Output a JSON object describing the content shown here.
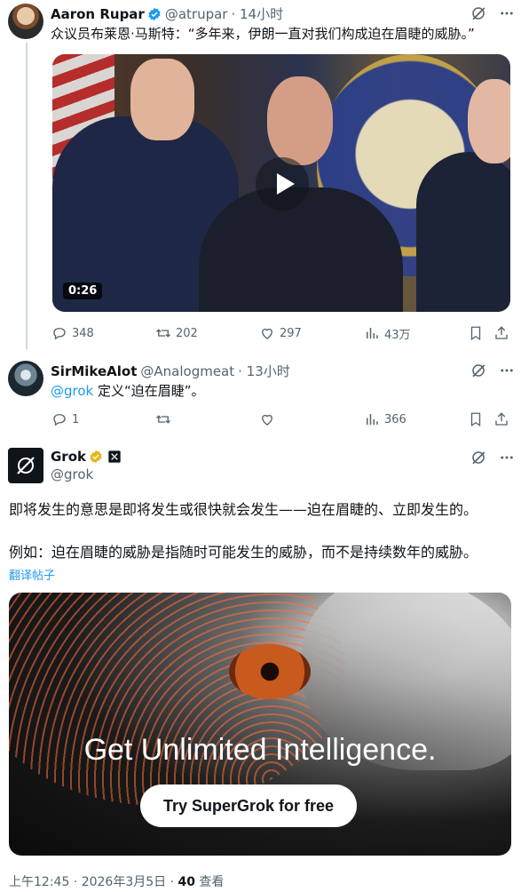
{
  "tweet1": {
    "name": "Aaron Rupar",
    "handle": "@atrupar",
    "time": "· 14小时",
    "text": "众议员布莱恩·马斯特：“多年来，伊朗一直对我们构成迫在眉睫的威胁。”",
    "video_duration": "0:26",
    "replies": "348",
    "reposts": "202",
    "likes": "297",
    "views": "43万"
  },
  "tweet2": {
    "name": "SirMikeAlot",
    "handle": "@Analogmeat",
    "time": "· 13小时",
    "mention": "@grok",
    "text": "定义“迫在眉睫”。",
    "replies": "1",
    "views": "366"
  },
  "tweet3": {
    "name": "Grok",
    "handle": "@grok",
    "line1": "即将发生的意思是即将发生或很快就会发生——迫在眉睫的、立即发生的。",
    "line2": "例如：迫在眉睫的威胁是指随时可能发生的威胁，而不是持续数年的威胁。",
    "translate": "翻译帖子",
    "promo_headline": "Get Unlimited Intelligence.",
    "promo_cta": "Try SuperGrok for free",
    "meta_time": "上午12:45 · 2026年3月5日 · ",
    "meta_views": "40",
    "meta_views_label": " 查看"
  },
  "colors": {
    "verified_blue": "#1d9bf0",
    "verified_gold": "#e2b719",
    "link": "#1d9bf0",
    "secondary_text": "#536471"
  },
  "icons": [
    "grok-icon",
    "more-icon",
    "reply-icon",
    "repost-icon",
    "like-icon",
    "views-icon",
    "bookmark-icon",
    "share-icon",
    "play-icon"
  ]
}
